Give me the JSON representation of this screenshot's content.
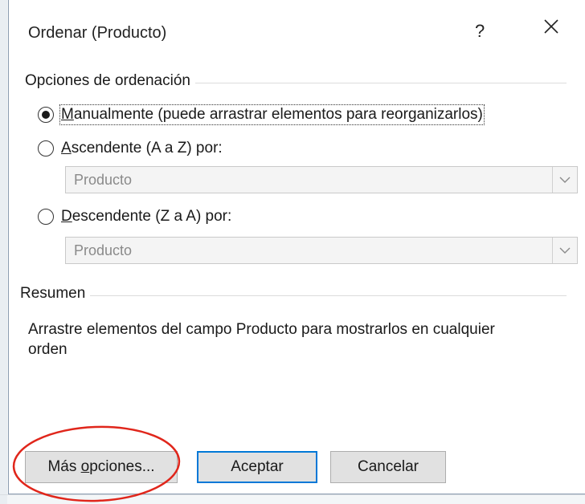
{
  "dialog": {
    "title": "Ordenar (Producto)",
    "help_label": "?",
    "close_label": "✕"
  },
  "sort_options": {
    "group_label": "Opciones de ordenación",
    "manual": {
      "label_prefix": "",
      "label_access": "M",
      "label_rest": "anualmente (puede arrastrar elementos para reorganizarlos)",
      "selected": true
    },
    "ascending": {
      "label_access": "A",
      "label_rest": "scendente (A a Z) por:",
      "selected": false,
      "field_value": "Producto"
    },
    "descending": {
      "label_access": "D",
      "label_rest": "escendente (Z a A) por:",
      "selected": false,
      "field_value": "Producto"
    }
  },
  "summary": {
    "group_label": "Resumen",
    "text": "Arrastre elementos del campo Producto para mostrarlos en cualquier orden"
  },
  "buttons": {
    "more_options_pre": "Más ",
    "more_options_access": "o",
    "more_options_post": "pciones...",
    "ok": "Aceptar",
    "cancel": "Cancelar"
  },
  "colors": {
    "accent": "#0078d7",
    "annotation": "#e0261b"
  }
}
